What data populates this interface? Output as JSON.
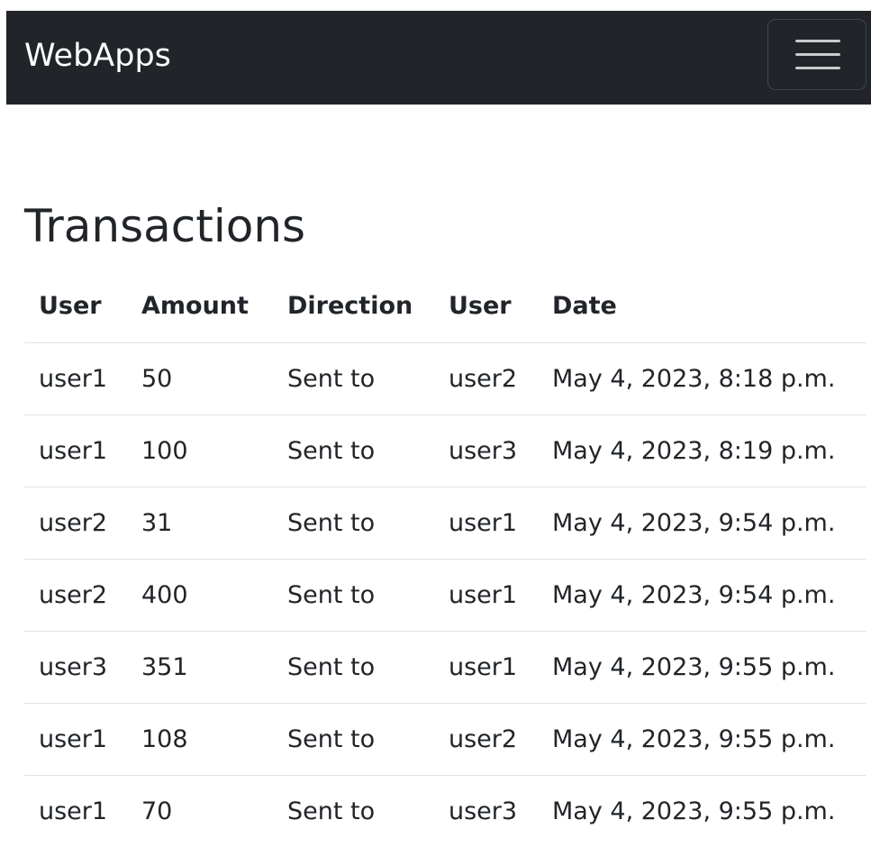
{
  "navbar": {
    "brand": "WebApps",
    "toggler_icon": "hamburger-menu-icon",
    "background_color": "#212529"
  },
  "page": {
    "title": "Transactions"
  },
  "table": {
    "headers": [
      "User",
      "Amount",
      "Direction",
      "User",
      "Date"
    ],
    "rows": [
      [
        "user1",
        "50",
        "Sent to",
        "user2",
        "May 4, 2023, 8:18 p.m."
      ],
      [
        "user1",
        "100",
        "Sent to",
        "user3",
        "May 4, 2023, 8:19 p.m."
      ],
      [
        "user2",
        "31",
        "Sent to",
        "user1",
        "May 4, 2023, 9:54 p.m."
      ],
      [
        "user2",
        "400",
        "Sent to",
        "user1",
        "May 4, 2023, 9:54 p.m."
      ],
      [
        "user3",
        "351",
        "Sent to",
        "user1",
        "May 4, 2023, 9:55 p.m."
      ],
      [
        "user1",
        "108",
        "Sent to",
        "user2",
        "May 4, 2023, 9:55 p.m."
      ],
      [
        "user1",
        "70",
        "Sent to",
        "user3",
        "May 4, 2023, 9:55 p.m."
      ]
    ]
  }
}
